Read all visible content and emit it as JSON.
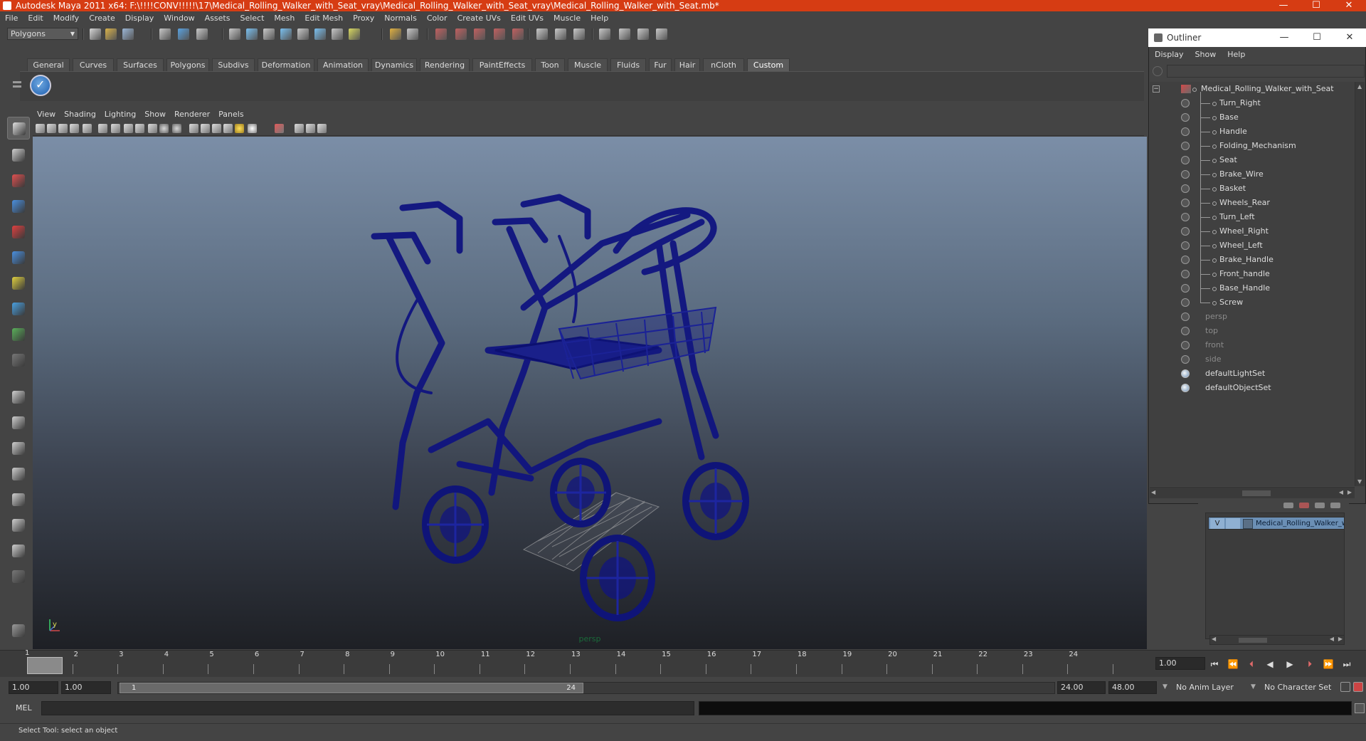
{
  "window": {
    "title": "Autodesk Maya 2011 x64: F:\\!!!!CONV!!!!!\\17\\Medical_Rolling_Walker_with_Seat_vray\\Medical_Rolling_Walker_with_Seat_vray\\Medical_Rolling_Walker_with_Seat.mb*",
    "minimize": "—",
    "maximize": "☐",
    "close": "✕"
  },
  "menubar": [
    "File",
    "Edit",
    "Modify",
    "Create",
    "Display",
    "Window",
    "Assets",
    "Select",
    "Mesh",
    "Edit Mesh",
    "Proxy",
    "Normals",
    "Color",
    "Create UVs",
    "Edit UVs",
    "Muscle",
    "Help"
  ],
  "toolbar": {
    "mode": "Polygons"
  },
  "shelf": {
    "tabs": [
      "General",
      "Curves",
      "Surfaces",
      "Polygons",
      "Subdivs",
      "Deformation",
      "Animation",
      "Dynamics",
      "Rendering",
      "PaintEffects",
      "Toon",
      "Muscle",
      "Fluids",
      "Fur",
      "Hair",
      "nCloth",
      "Custom"
    ],
    "active": "Custom"
  },
  "viewport": {
    "menu": [
      "View",
      "Shading",
      "Lighting",
      "Show",
      "Renderer",
      "Panels"
    ],
    "camera": "persp",
    "axis_label": "y",
    "wire_color": "#101480"
  },
  "outliner": {
    "title": "Outliner",
    "menu": [
      "Display",
      "Show",
      "Help"
    ],
    "root": "Medical_Rolling_Walker_with_Seat",
    "children": [
      "Turn_Right",
      "Base",
      "Handle",
      "Folding_Mechanism",
      "Seat",
      "Brake_Wire",
      "Basket",
      "Wheels_Rear",
      "Turn_Left",
      "Wheel_Right",
      "Wheel_Left",
      "Brake_Handle",
      "Front_handle",
      "Base_Handle",
      "Screw"
    ],
    "cameras": [
      "persp",
      "top",
      "front",
      "side"
    ],
    "sets": [
      "defaultLightSet",
      "defaultObjectSet"
    ]
  },
  "layers": {
    "visible_flag": "V",
    "layer_name": "Medical_Rolling_Walker_w"
  },
  "timeline": {
    "frames": [
      "1",
      "2",
      "3",
      "4",
      "5",
      "6",
      "7",
      "8",
      "9",
      "10",
      "11",
      "12",
      "13",
      "14",
      "15",
      "16",
      "17",
      "18",
      "19",
      "20",
      "21",
      "22",
      "23",
      "24"
    ],
    "current_frame_field": "1.00",
    "current_frame_marker": "1"
  },
  "range": {
    "start": "1.00",
    "playback_start": "1.00",
    "handle_start": "1",
    "handle_end": "24",
    "playback_end": "24.00",
    "end": "48.00",
    "anim_layer": "No Anim Layer",
    "character_set": "No Character Set"
  },
  "commandline": {
    "label": "MEL"
  },
  "helpline": {
    "text": "Select Tool: select an object"
  }
}
